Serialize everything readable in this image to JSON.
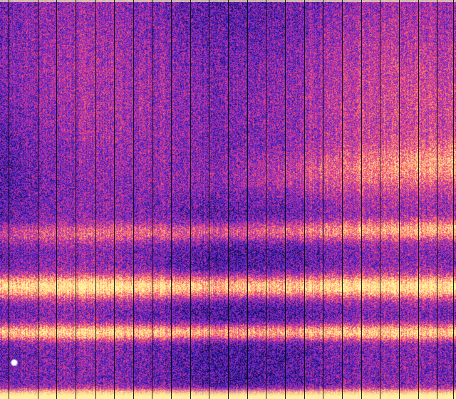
{
  "image": {
    "subject": "spectrogram",
    "colormap": [
      "#0a0635",
      "#2a1fb8",
      "#7a2ad0",
      "#d0309a",
      "#ff5a6a",
      "#ffb070",
      "#fff2a0"
    ],
    "background_color": "#2a1fb8",
    "highlight_color": "#fff2a0",
    "divider_color": "#000000",
    "divider_count": 24
  }
}
